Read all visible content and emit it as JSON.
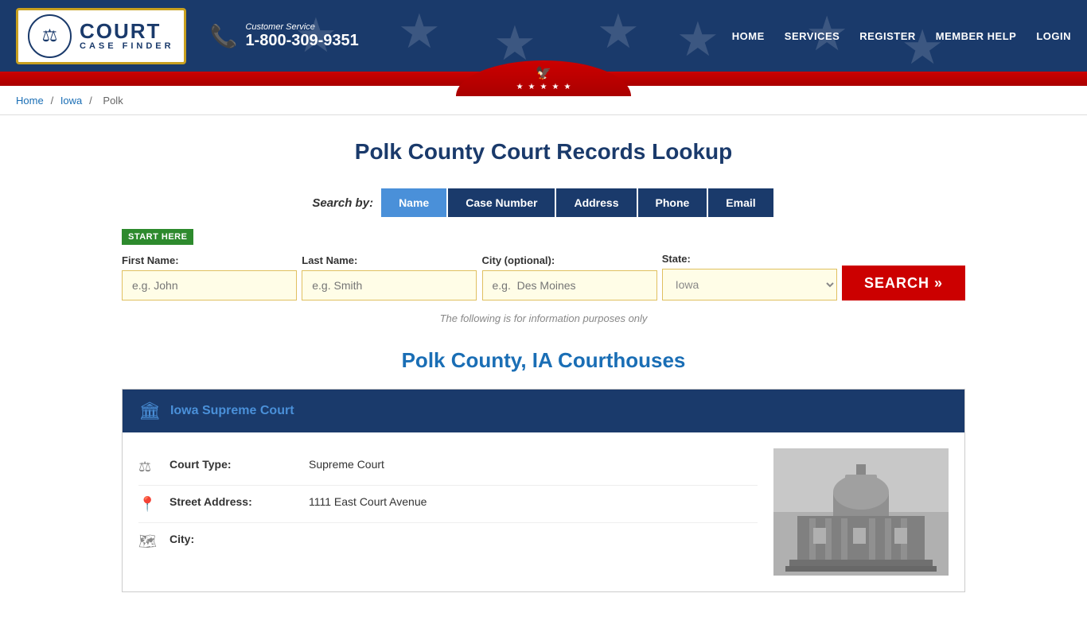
{
  "header": {
    "logo_court": "COURT",
    "logo_case_finder": "CASE FINDER",
    "phone_label": "Customer Service",
    "phone_number": "1-800-309-9351",
    "nav": [
      {
        "label": "HOME",
        "href": "#"
      },
      {
        "label": "SERVICES",
        "href": "#"
      },
      {
        "label": "REGISTER",
        "href": "#"
      },
      {
        "label": "MEMBER HELP",
        "href": "#"
      },
      {
        "label": "LOGIN",
        "href": "#"
      }
    ]
  },
  "breadcrumb": {
    "home": "Home",
    "state": "Iowa",
    "county": "Polk"
  },
  "page_title": "Polk County Court Records Lookup",
  "search": {
    "label": "Search by:",
    "tabs": [
      {
        "label": "Name",
        "active": true
      },
      {
        "label": "Case Number",
        "active": false
      },
      {
        "label": "Address",
        "active": false
      },
      {
        "label": "Phone",
        "active": false
      },
      {
        "label": "Email",
        "active": false
      }
    ],
    "start_here": "START HERE",
    "fields": {
      "first_name_label": "First Name:",
      "first_name_placeholder": "e.g. John",
      "last_name_label": "Last Name:",
      "last_name_placeholder": "e.g. Smith",
      "city_label": "City (optional):",
      "city_placeholder": "e.g.  Des Moines",
      "state_label": "State:",
      "state_value": "Iowa"
    },
    "search_button": "SEARCH »",
    "info_note": "The following is for information purposes only"
  },
  "courthouses_section": {
    "title": "Polk County, IA Courthouses",
    "items": [
      {
        "name": "Iowa Supreme Court",
        "href": "#",
        "court_type_label": "Court Type:",
        "court_type_value": "Supreme Court",
        "street_label": "Street Address:",
        "street_value": "1111 East Court Avenue",
        "city_label": "City:"
      }
    ]
  }
}
